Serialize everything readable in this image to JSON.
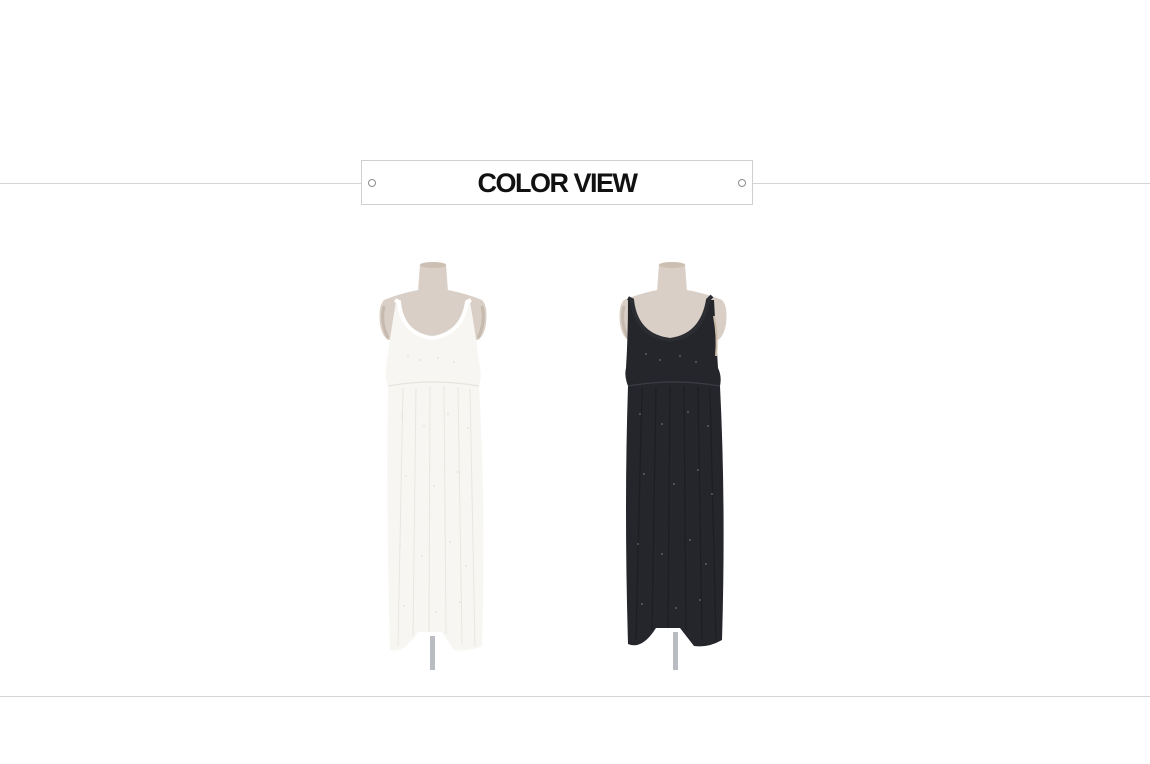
{
  "section": {
    "title": "COLOR VIEW"
  },
  "products": [
    {
      "name": "white-dress",
      "color": "#f7f6f2",
      "strap_color": "#ffffff",
      "dot_color": "#e2e0da"
    },
    {
      "name": "black-dress",
      "color": "#24262b",
      "strap_color": "#2b2d32",
      "dot_color": "#6b6e74"
    }
  ],
  "colors": {
    "mannequin_skin": "#d9cfc6",
    "mannequin_shade": "#c6b9ad",
    "stand": "#b9bcc0",
    "divider": "#d4d4d4"
  }
}
